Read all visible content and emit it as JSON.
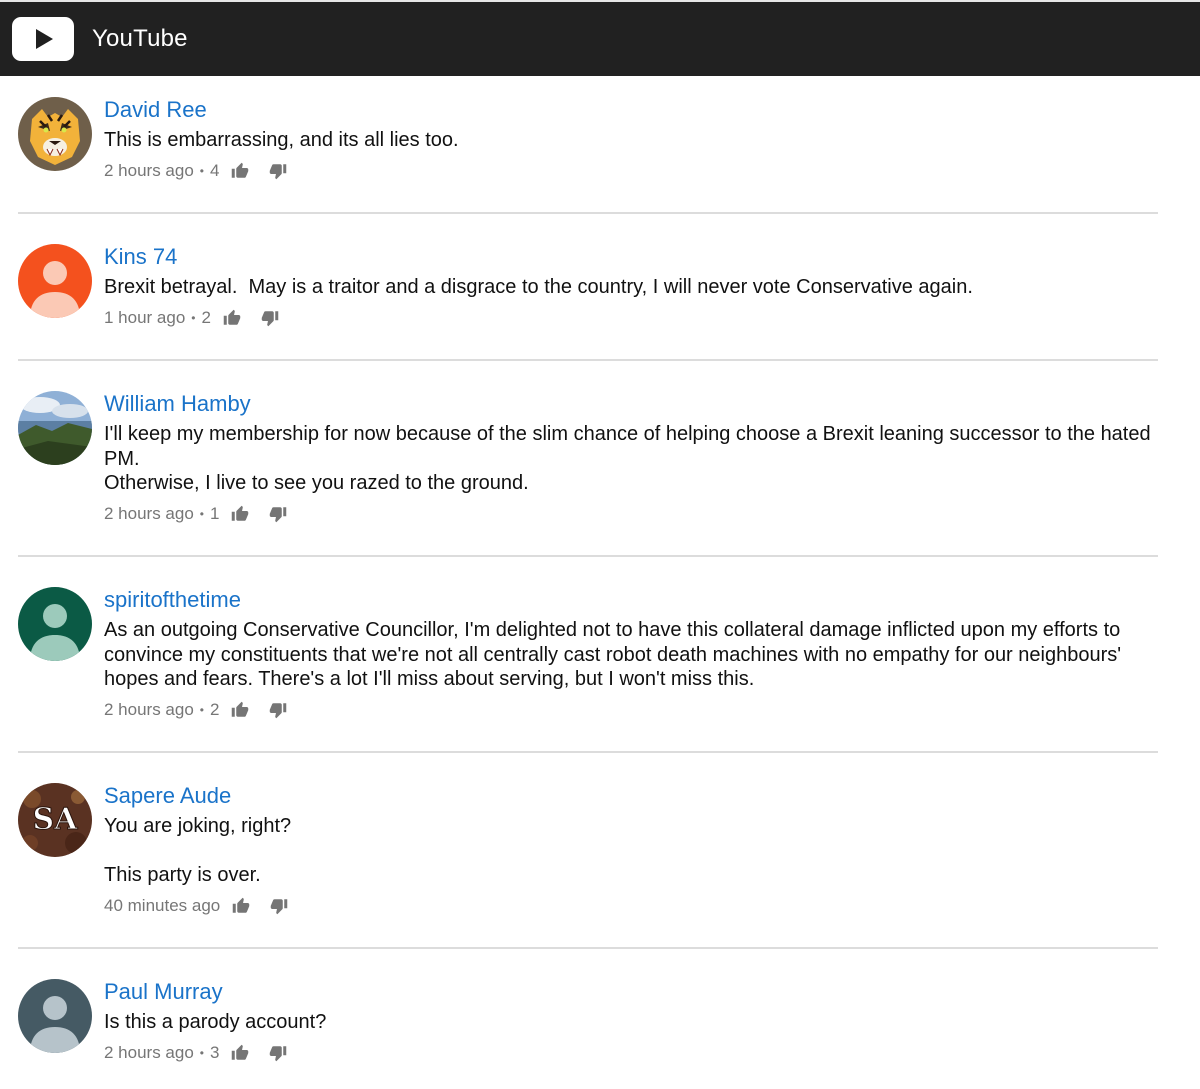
{
  "app": {
    "title": "YouTube",
    "logo_icon": "play-icon"
  },
  "colors": {
    "header_bg": "#212121",
    "author": "#1a73c9",
    "meta": "#767676"
  },
  "comments": [
    {
      "author": "David Ree",
      "text": "This is embarrassing, and its all lies too.",
      "time": "2 hours ago",
      "likes": "4",
      "avatar": "tiger-avatar"
    },
    {
      "author": "Kins 74",
      "text": "Brexit betrayal.  May is a traitor and a disgrace to the country, I will never vote Conservative again.",
      "time": "1 hour ago",
      "likes": "2",
      "avatar": "default-avatar-orange"
    },
    {
      "author": "William Hamby",
      "text": "I'll keep my membership for now because of the slim chance of helping choose a Brexit leaning successor to the hated PM.\nOtherwise, I live to see you razed to the ground.",
      "time": "2 hours ago",
      "likes": "1",
      "avatar": "coast-photo-avatar"
    },
    {
      "author": "spiritofthetime",
      "text": "As an outgoing Conservative Councillor, I'm delighted not to have this collateral damage inflicted upon my efforts to convince my constituents that we're not all centrally cast robot death machines with no empathy for our neighbours' hopes and fears. There's a lot I'll miss about serving, but I won't miss this.",
      "time": "2 hours ago",
      "likes": "2",
      "avatar": "default-avatar-green"
    },
    {
      "author": "Sapere Aude",
      "text": "You are joking, right?\n\nThis party is over.",
      "time": "40 minutes ago",
      "likes": "",
      "avatar": "sa-monogram-avatar",
      "avatar_text": "SA"
    },
    {
      "author": "Paul Murray",
      "text": "Is this a parody account?",
      "time": "2 hours ago",
      "likes": "3",
      "avatar": "default-avatar-slate"
    }
  ]
}
